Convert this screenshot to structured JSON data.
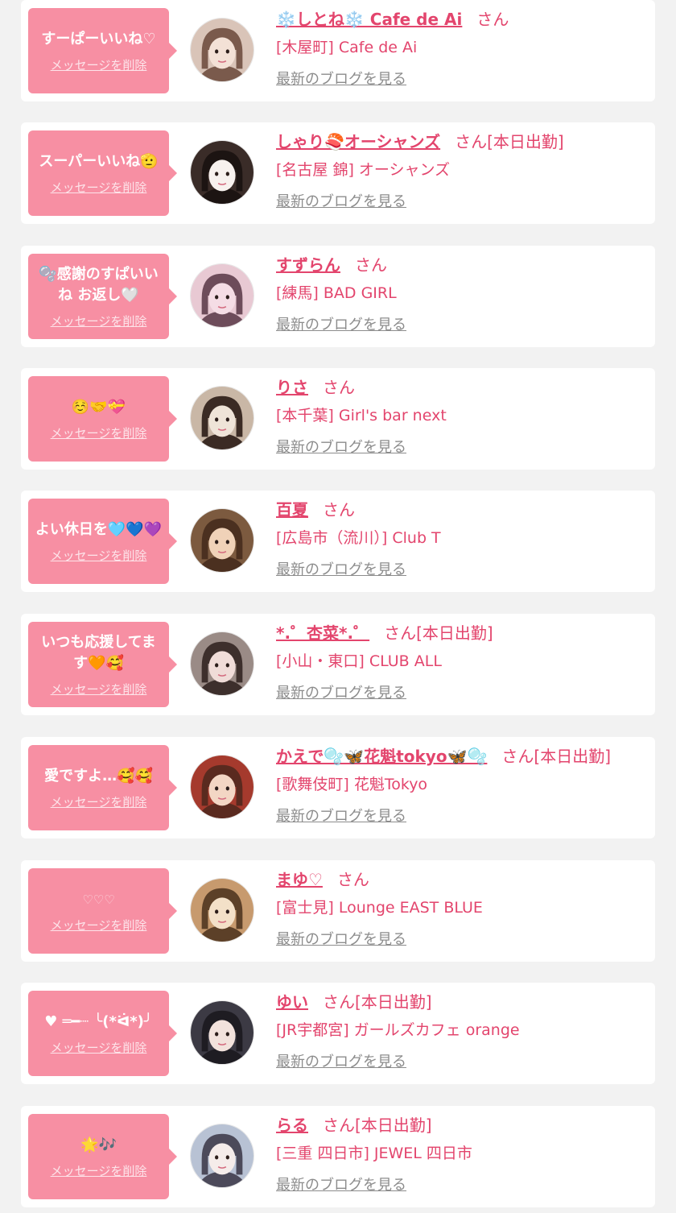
{
  "colors": {
    "page_background": "#f2f2f2",
    "card_background": "#ffffff",
    "bubble_pink": "#f78fa3",
    "accent_pink": "#e3456d",
    "link_gray": "#8c8c8c"
  },
  "labels": {
    "delete_message": "メッセージを削除",
    "see_latest_blog": "最新のブログを見る",
    "honorific": "さん"
  },
  "messages": [
    {
      "bubble": "すーぱーいいね♡",
      "name": "❄️しとね❄️ Cafe de Ai",
      "shift": "",
      "shop": "[木屋町] Cafe de Ai",
      "avatar_icon": "user-photo-icon"
    },
    {
      "bubble": "スーパーいいね🫡",
      "name": "しゃり🍣オーシャンズ",
      "shift": "[本日出勤]",
      "shop": "[名古屋 錦] オーシャンズ",
      "avatar_icon": "user-photo-icon"
    },
    {
      "bubble": "🫧感謝のすぱいいね お返し🤍",
      "name": "すずらん",
      "shift": "",
      "shop": "[練馬] BAD GIRL",
      "avatar_icon": "user-photo-icon"
    },
    {
      "bubble": "☺️🤝💝",
      "name": "りさ",
      "shift": "",
      "shop": "[本千葉] Girl's bar next",
      "avatar_icon": "user-photo-icon"
    },
    {
      "bubble": "よい休日を🩵💙💜",
      "name": "百夏",
      "shift": "",
      "shop": "[広島市（流川）] Club T",
      "avatar_icon": "user-photo-icon"
    },
    {
      "bubble": "いつも応援してます🧡🥰",
      "name": "*.゜杏菜*.゜",
      "shift": "[本日出勤]",
      "shop": "[小山・東口] CLUB ALL",
      "avatar_icon": "user-photo-icon"
    },
    {
      "bubble": "愛ですよ…🥰🥰",
      "name": "かえで🫧🦋花魁tokyo🦋🫧",
      "shift": "[本日出勤]",
      "shop": "[歌舞伎町] 花魁Tokyo",
      "avatar_icon": "user-photo-icon"
    },
    {
      "bubble": "♡♡♡",
      "name": "まゆ♡",
      "shift": "",
      "shop": "[富士見] Lounge EAST BLUE",
      "avatar_icon": "user-photo-icon"
    },
    {
      "bubble": "♥ ═━┈ ╰(*ᐛ*)╯",
      "name": "ゆい",
      "shift": "[本日出勤]",
      "shop": "[JR宇都宮] ガールズカフェ orange",
      "avatar_icon": "user-photo-icon"
    },
    {
      "bubble": "🌟🎶",
      "name": "らる",
      "shift": "[本日出勤]",
      "shop": "[三重 四日市] JEWEL 四日市",
      "avatar_icon": "user-photo-icon"
    }
  ]
}
